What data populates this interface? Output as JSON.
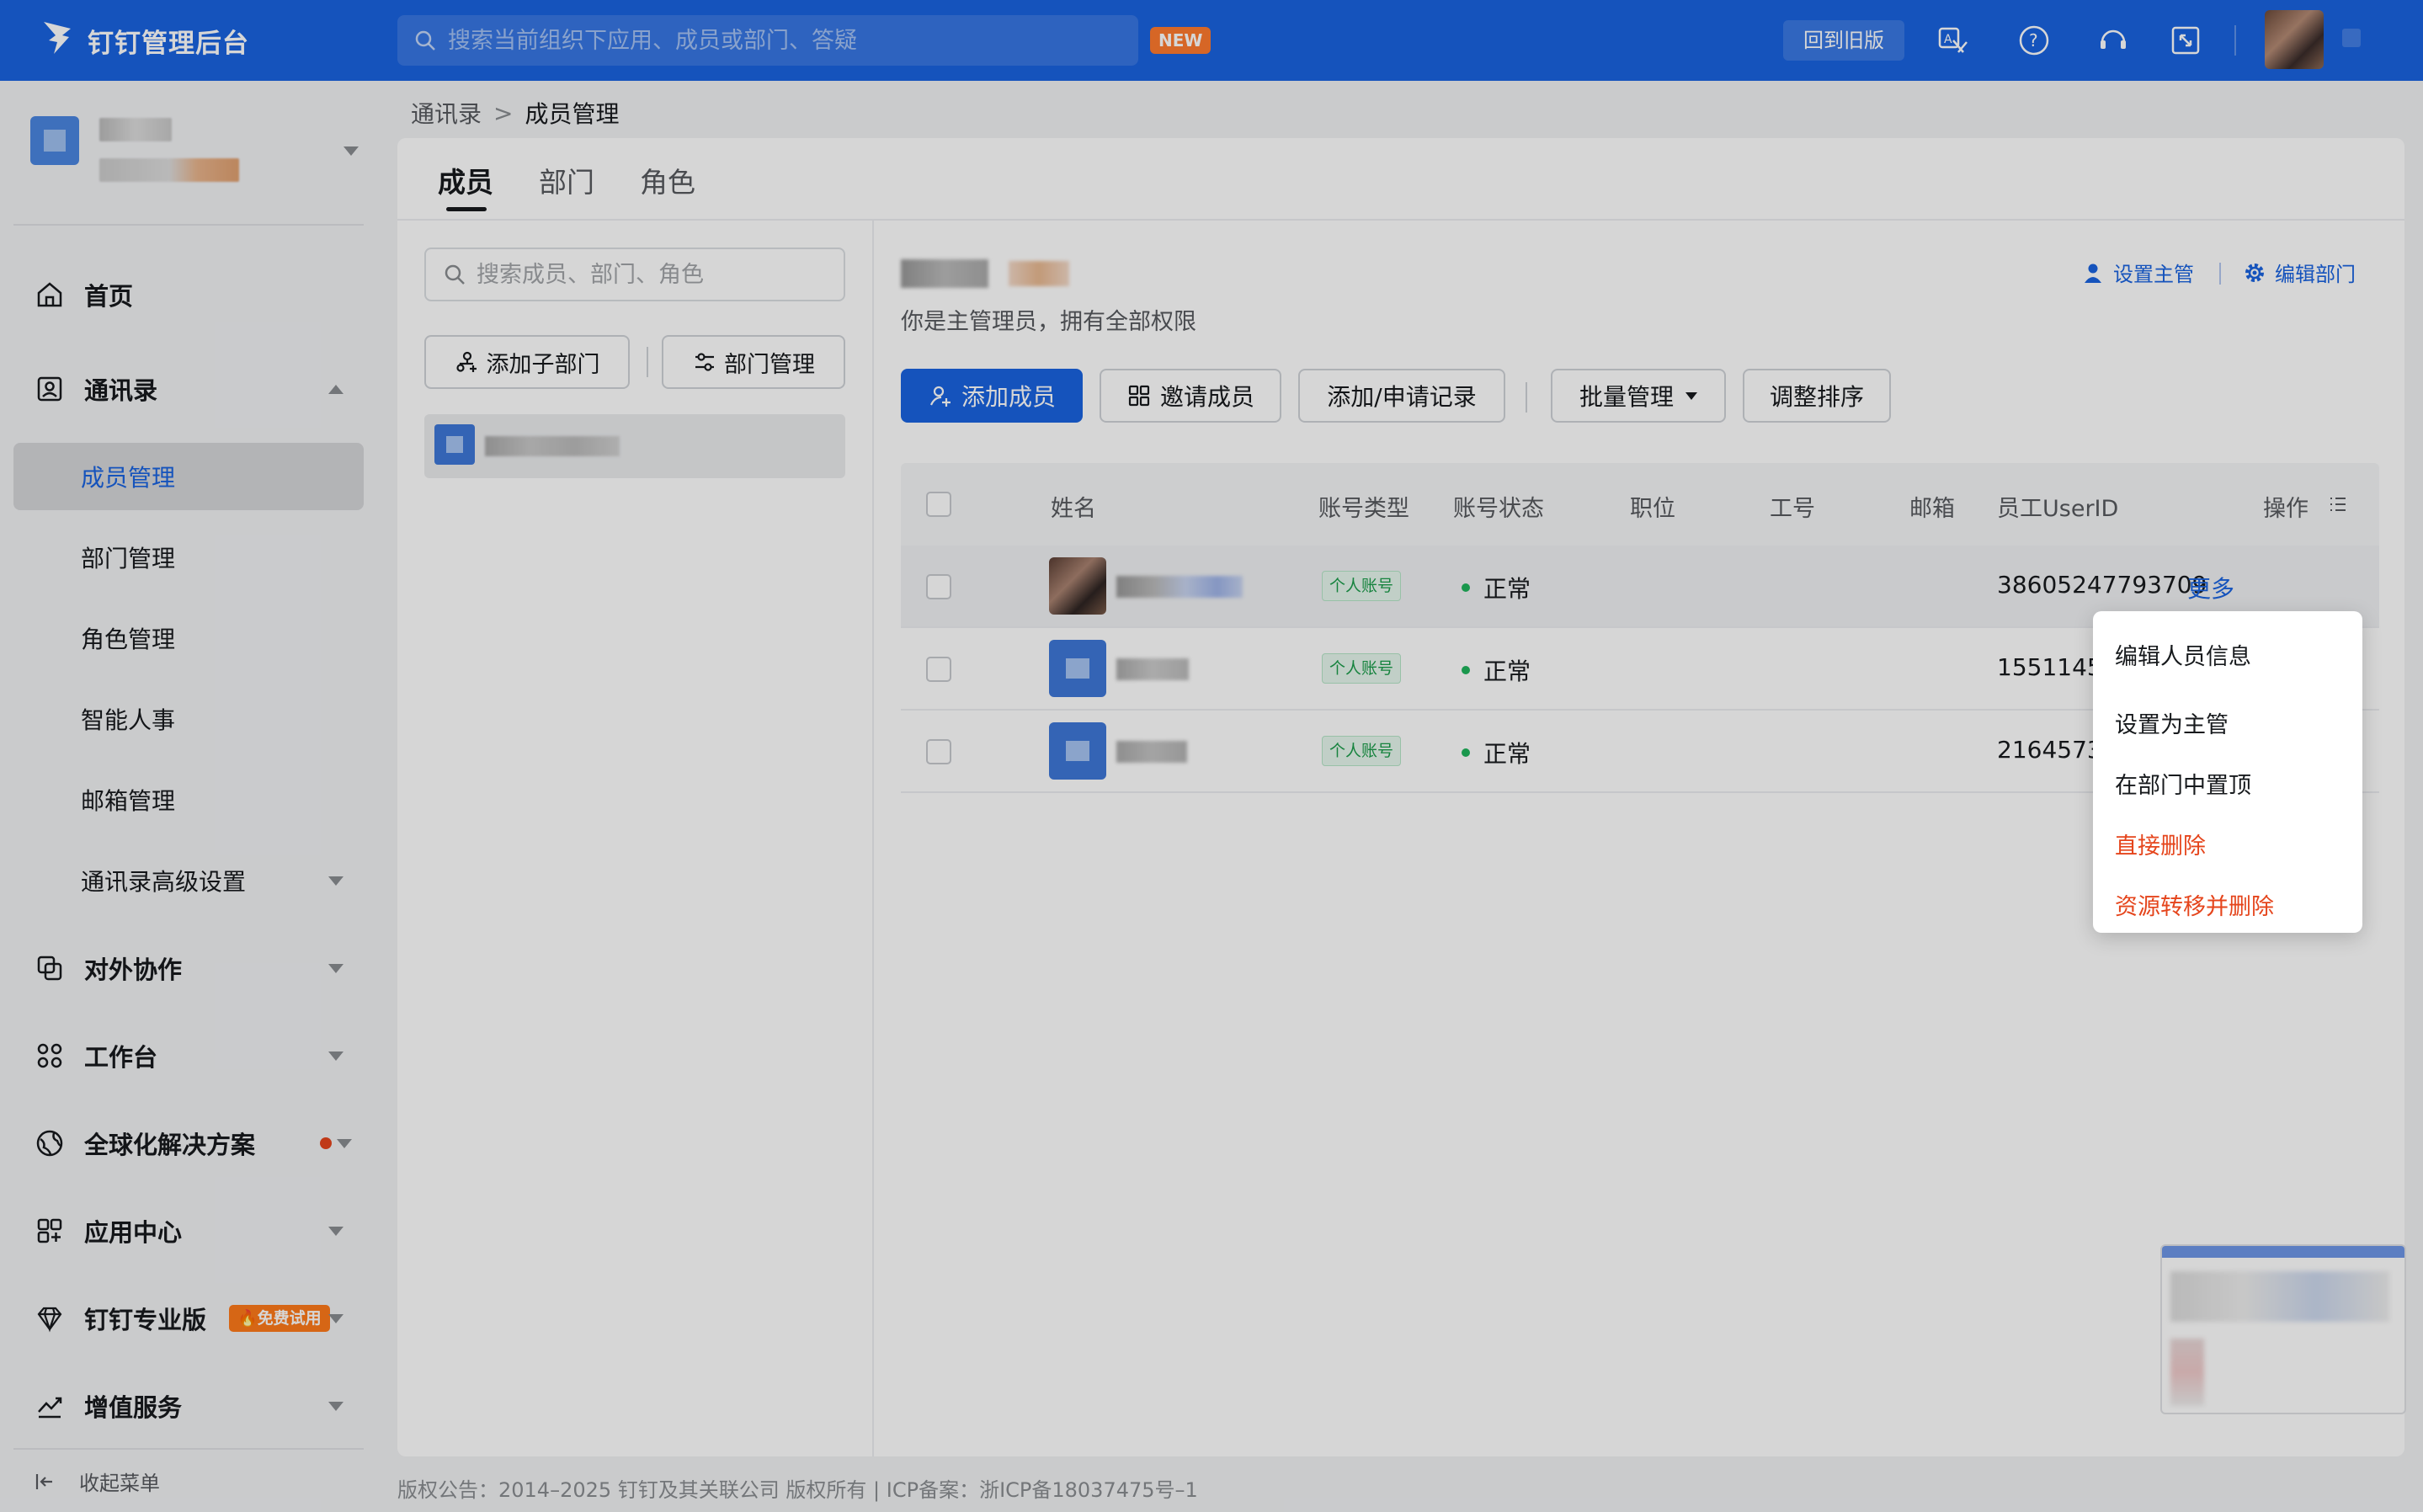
{
  "header": {
    "brand": "钉钉管理后台",
    "search_placeholder": "搜索当前组织下应用、成员或部门、答疑",
    "new_badge": "NEW",
    "old_version": "回到旧版"
  },
  "sidebar": {
    "nav": [
      {
        "label": "首页",
        "icon": "home-icon"
      },
      {
        "label": "通讯录",
        "icon": "contacts-icon"
      },
      {
        "label": "对外协作",
        "icon": "external-collab-icon"
      },
      {
        "label": "工作台",
        "icon": "workbench-icon"
      },
      {
        "label": "全球化解决方案",
        "icon": "globe-icon"
      },
      {
        "label": "应用中心",
        "icon": "app-center-icon"
      },
      {
        "label": "钉钉专业版",
        "icon": "diamond-icon",
        "badge": "🔥免费试用"
      },
      {
        "label": "增值服务",
        "icon": "trend-chart-icon"
      }
    ],
    "sub": [
      "成员管理",
      "部门管理",
      "角色管理",
      "智能人事",
      "邮箱管理",
      "通讯录高级设置"
    ],
    "collapse": "收起菜单"
  },
  "breadcrumb": {
    "root": "通讯录",
    "sep": ">",
    "current": "成员管理"
  },
  "tabs": [
    "成员",
    "部门",
    "角色"
  ],
  "leftpane": {
    "search_placeholder": "搜索成员、部门、角色",
    "add_sub_dept": "添加子部门",
    "dept_manage": "部门管理"
  },
  "dept": {
    "desc": "你是主管理员，拥有全部权限",
    "set_manager": "设置主管",
    "link_sep": "|",
    "edit_dept": "编辑部门"
  },
  "actions": {
    "add_member": "添加成员",
    "invite": "邀请成员",
    "records": "添加/申请记录",
    "batch": "批量管理",
    "sort": "调整排序"
  },
  "table": {
    "headers": [
      "姓名",
      "账号类型",
      "账号状态",
      "职位",
      "工号",
      "邮箱",
      "员工UserID",
      "操作"
    ],
    "rows": [
      {
        "type": "个人账号",
        "status": "正常",
        "uid": "38605247793709",
        "action": "更多"
      },
      {
        "type": "个人账号",
        "status": "正常",
        "uid": "15511457"
      },
      {
        "type": "个人账号",
        "status": "正常",
        "uid": "2164573"
      }
    ]
  },
  "dropdown": [
    "编辑人员信息",
    "设置为主管",
    "在部门中置顶",
    "直接删除",
    "资源转移并删除"
  ],
  "footer": "版权公告：2014–2025 钉钉及其关联公司 版权所有 | ICP备案：浙ICP备18037475号–1",
  "colors": {
    "primary": "#1a63e0",
    "danger": "#e5451c",
    "success": "#1fb45c"
  }
}
